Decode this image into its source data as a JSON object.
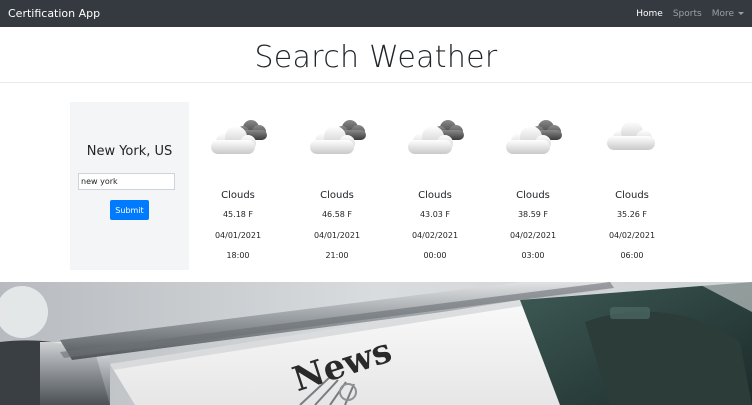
{
  "app": {
    "title": "Certification App"
  },
  "nav": {
    "items": [
      {
        "label": "Home",
        "active": true
      },
      {
        "label": "Sports",
        "active": false
      },
      {
        "label": "More",
        "active": false,
        "dropdown": true
      }
    ]
  },
  "page": {
    "title": "Search Weather"
  },
  "search": {
    "city": "New York, US",
    "input_value": "new york",
    "submit_label": "Submit"
  },
  "forecast": [
    {
      "condition": "Clouds",
      "temp": "45.18 F",
      "date": "04/01/2021",
      "time": "18:00",
      "icon": "partly-cloudy-icon"
    },
    {
      "condition": "Clouds",
      "temp": "46.58 F",
      "date": "04/01/2021",
      "time": "21:00",
      "icon": "partly-cloudy-icon"
    },
    {
      "condition": "Clouds",
      "temp": "43.03 F",
      "date": "04/02/2021",
      "time": "00:00",
      "icon": "partly-cloudy-icon"
    },
    {
      "condition": "Clouds",
      "temp": "38.59 F",
      "date": "04/02/2021",
      "time": "03:00",
      "icon": "partly-cloudy-icon"
    },
    {
      "condition": "Clouds",
      "temp": "35.26 F",
      "date": "04/02/2021",
      "time": "06:00",
      "icon": "cloud-icon"
    }
  ],
  "banner": {
    "text": "News"
  },
  "colors": {
    "navbar": "#343a40",
    "primary": "#007bff",
    "card": "#f4f5f6"
  }
}
